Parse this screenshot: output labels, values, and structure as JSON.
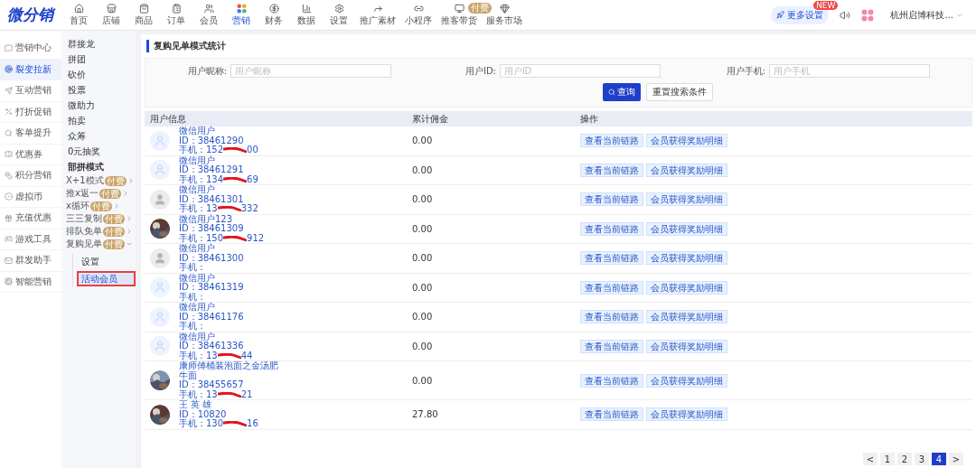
{
  "top_nav": {
    "logo": "微分销",
    "items": [
      {
        "label": "首页",
        "selected": false
      },
      {
        "label": "店铺",
        "selected": false
      },
      {
        "label": "商品",
        "selected": false
      },
      {
        "label": "订单",
        "selected": false
      },
      {
        "label": "会员",
        "selected": false
      },
      {
        "label": "营销",
        "selected": true
      },
      {
        "label": "财务",
        "selected": false
      },
      {
        "label": "数据",
        "selected": false
      },
      {
        "label": "设置",
        "selected": false
      },
      {
        "label": "推广素材",
        "selected": false
      },
      {
        "label": "小程序",
        "selected": false
      },
      {
        "label": "推客带货",
        "selected": false,
        "badge": "付费"
      },
      {
        "label": "服务市场",
        "selected": false
      }
    ],
    "more_settings": {
      "label": "更多设置",
      "badge": "NEW"
    },
    "account": "杭州启博科技..."
  },
  "sidebar": {
    "items": [
      {
        "label": "营销中心",
        "selected": false
      },
      {
        "label": "裂变拉新",
        "selected": true
      },
      {
        "label": "互动营销",
        "selected": false
      },
      {
        "label": "打折促销",
        "selected": false
      },
      {
        "label": "客单提升",
        "selected": false
      },
      {
        "label": "优惠券",
        "selected": false
      },
      {
        "label": "积分营销",
        "selected": false
      },
      {
        "label": "虚拟币",
        "selected": false
      },
      {
        "label": "充值优惠",
        "selected": false
      },
      {
        "label": "游戏工具",
        "selected": false
      },
      {
        "label": "群发助手",
        "selected": false
      },
      {
        "label": "智能营销",
        "selected": false
      }
    ]
  },
  "subnav": {
    "items": [
      "群接龙",
      "拼团",
      "砍价",
      "投票",
      "微助力",
      "拍卖",
      "众筹",
      "0元抽奖"
    ],
    "group_title": "部拼模式",
    "modes": [
      {
        "label": "X+1模式",
        "badge": "付费",
        "expanded": false
      },
      {
        "label": "推x返一",
        "badge": "付费",
        "expanded": false
      },
      {
        "label": "x循环",
        "badge": "付费",
        "expanded": false
      },
      {
        "label": "三三复制",
        "badge": "付费",
        "expanded": false
      },
      {
        "label": "排队免单",
        "badge": "付费",
        "expanded": false
      },
      {
        "label": "复购见单",
        "badge": "付费",
        "expanded": true,
        "children": [
          {
            "label": "设置",
            "selected": false
          },
          {
            "label": "活动会员",
            "selected": true
          }
        ]
      }
    ]
  },
  "page_title": "复购见单模式统计",
  "search": {
    "fields": [
      {
        "label": "用户昵称:",
        "placeholder": "用户昵称"
      },
      {
        "label": "用户ID:",
        "placeholder": "用户ID"
      },
      {
        "label": "用户手机:",
        "placeholder": "用户手机"
      }
    ],
    "search_button": "查询",
    "reset_button": "重置搜索条件"
  },
  "table": {
    "columns": [
      "用户信息",
      "累计佣金",
      "操作"
    ],
    "rows": [
      {
        "kind": "default",
        "name": "微信用户",
        "id": "ID：38461290",
        "phone": "手机：152",
        "phone_tail": "00",
        "redacted": true,
        "commission": "0.00",
        "actions": [
          "查看当前链路",
          "会员获得奖励明细"
        ]
      },
      {
        "kind": "default",
        "name": "微信用户",
        "id": "ID：38461291",
        "phone": "手机：134",
        "phone_tail": "69",
        "redacted": true,
        "commission": "0.00",
        "actions": [
          "查看当前链路",
          "会员获得奖励明细"
        ]
      },
      {
        "kind": "grey",
        "name": "微信用户",
        "id": "ID：38461301",
        "phone": "手机：13",
        "phone_tail": "332",
        "redacted": true,
        "commission": "0.00",
        "actions": [
          "查看当前链路",
          "会员获得奖励明细"
        ]
      },
      {
        "name": "微信用户123",
        "id": "ID：38461309",
        "phone": "手机：150",
        "phone_tail": "912",
        "redacted": true,
        "commission": "0.00",
        "actions": [
          "查看当前链路",
          "会员获得奖励明细"
        ]
      },
      {
        "kind": "grey",
        "name": "微信用户",
        "id": "ID：38461300",
        "phone": "手机：",
        "redacted": false,
        "commission": "0.00",
        "actions": [
          "查看当前链路",
          "会员获得奖励明细"
        ]
      },
      {
        "kind": "default",
        "name": "微信用户",
        "id": "ID：38461319",
        "phone": "手机：",
        "redacted": false,
        "commission": "0.00",
        "actions": [
          "查看当前链路",
          "会员获得奖励明细"
        ]
      },
      {
        "kind": "default",
        "name": "微信用户",
        "id": "ID：38461176",
        "phone": "手机：",
        "redacted": false,
        "commission": "0.00",
        "actions": [
          "查看当前链路",
          "会员获得奖励明细"
        ]
      },
      {
        "kind": "default",
        "name": "微信用户",
        "id": "ID：38461336",
        "phone": "手机：13",
        "phone_tail": "44",
        "redacted": true,
        "commission": "0.00",
        "actions": [
          "查看当前链路",
          "会员获得奖励明细"
        ]
      },
      {
        "name": "康师傅桶装泡面之金汤肥牛面",
        "id": "ID：38455657",
        "phone": "手机：13",
        "phone_tail": "21",
        "redacted": true,
        "commission": "0.00",
        "actions": [
          "查看当前链路",
          "会员获得奖励明细"
        ]
      },
      {
        "name": "王 英 雄",
        "id": "ID：10820",
        "phone": "手机：130",
        "phone_tail": "16",
        "redacted": true,
        "commission": "27.80",
        "actions": [
          "查看当前链路",
          "会员获得奖励明细"
        ]
      }
    ]
  },
  "pagination": {
    "prev": "<",
    "pages": [
      {
        "label": "1",
        "selected": false
      },
      {
        "label": "2",
        "selected": false
      },
      {
        "label": "3",
        "selected": false
      },
      {
        "label": "4",
        "selected": true
      }
    ],
    "next": ">"
  }
}
